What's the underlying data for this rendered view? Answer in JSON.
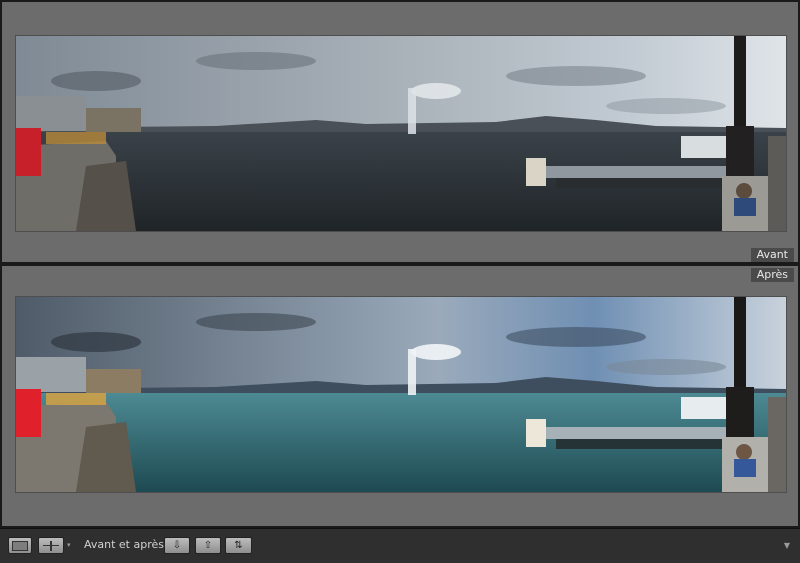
{
  "labels": {
    "before": "Avant",
    "after": "Après"
  },
  "toolbar": {
    "view_mode_single_icon": "single-view-icon",
    "view_mode_split_icon": "before-after-split-icon",
    "before_after_label": "Avant et après :",
    "copy_before_to_after_icon": "arrow-down-icon",
    "copy_after_to_before_icon": "arrow-up-icon",
    "swap_icon": "swap-arrows-icon",
    "dropdown_glyph": "▾",
    "menu_glyph": "▼",
    "copy_down_glyph": "⇩",
    "copy_up_glyph": "⇧",
    "swap_glyph": "⇅"
  },
  "colors": {
    "app_background": "#6c6c6c",
    "toolbar_background": "#2f2f2f",
    "label_background": "#4a4a4a"
  }
}
